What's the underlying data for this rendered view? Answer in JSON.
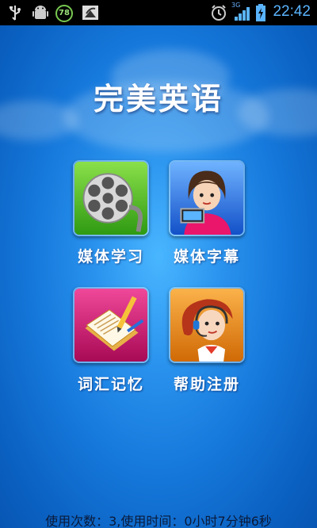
{
  "status_bar": {
    "time": "22:42",
    "battery_badge": "78",
    "network_label": "3G",
    "icons": [
      "usb-icon",
      "android-debug-icon",
      "battery-level-icon",
      "screenshot-icon",
      "alarm-icon",
      "signal-icon",
      "battery-charging-icon"
    ]
  },
  "app": {
    "title": "完美英语"
  },
  "menu": {
    "items": [
      {
        "label": "媒体学习",
        "icon": "film-reel-icon",
        "color": "#3fae1d"
      },
      {
        "label": "媒体字幕",
        "icon": "presenter-girl-icon",
        "color": "#1a63d6"
      },
      {
        "label": "词汇记忆",
        "icon": "notebook-pencil-icon",
        "color": "#c8106a"
      },
      {
        "label": "帮助注册",
        "icon": "support-headset-icon",
        "color": "#e78a12"
      }
    ]
  },
  "footer": {
    "usage_text": "使用次数：3,使用时间：0小时7分钟6秒"
  }
}
